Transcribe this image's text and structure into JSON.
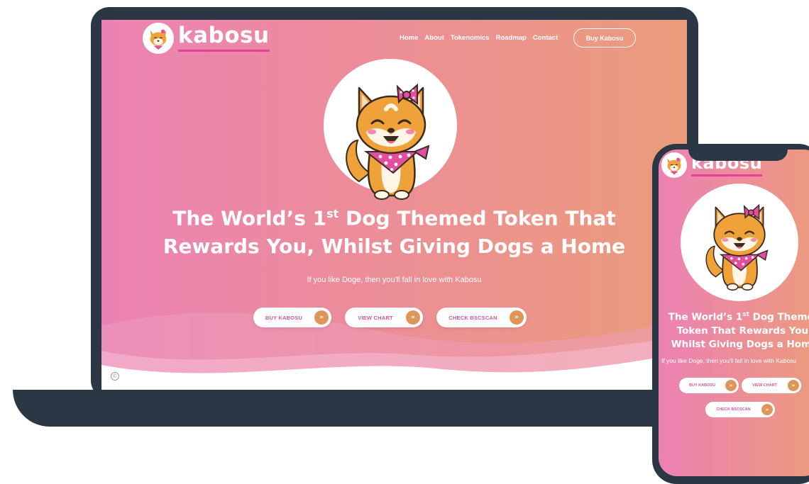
{
  "brand": {
    "name": "kabosu"
  },
  "nav": {
    "items": [
      "Home",
      "About",
      "Tokenomics",
      "Roadmap",
      "Contact"
    ],
    "cta": "Buy Kabosu"
  },
  "hero": {
    "headline_line1_pre": "The World’s 1",
    "headline_sup": "st",
    "headline_line1_post": " Dog Themed Token That",
    "headline_line2": "Rewards You, Whilst Giving Dogs a Home",
    "subheadline": "If you like Doge, then you'll fall in love with Kabosu",
    "buttons": [
      "BUY KABOSU",
      "VIEW CHART",
      "CHECK BSCSCAN"
    ],
    "button_icon": "double-chevron-right-icon"
  },
  "mobile": {
    "headline_pre": "The World’s 1",
    "headline_sup": "st",
    "headline_post": " Dog Themed Token That Rewards You, Whilst Giving Dogs a Home",
    "subheadline": "If you like Doge, then you'll fall in love with Kabosu"
  },
  "footer": {
    "copyright_icon": "©"
  },
  "colors": {
    "gradient_start": "#ec82b4",
    "gradient_end": "#eb9c7c",
    "accent_pink": "#e83e9c",
    "button_text": "#d0579b",
    "arrow_orange": "#e0965a",
    "device_frame": "#2b3744"
  }
}
